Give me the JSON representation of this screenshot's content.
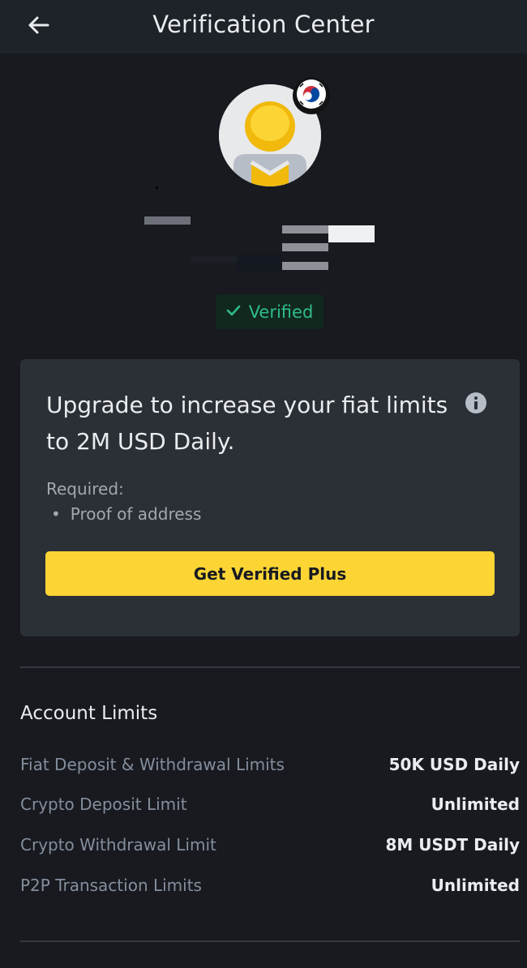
{
  "header": {
    "title": "Verification Center",
    "back_icon": "arrow-left-icon"
  },
  "profile": {
    "avatar_icon": "default-avatar-icon",
    "country_flag_icon": "south-korea-flag-icon",
    "status": "Verified"
  },
  "upgrade_card": {
    "title": "Upgrade to increase your fiat limits to 2M USD Daily.",
    "info_icon": "info-icon",
    "required_label": "Required:",
    "required_items": [
      "Proof of address"
    ],
    "button_label": "Get Verified Plus"
  },
  "account_limits": {
    "heading": "Account Limits",
    "rows": [
      {
        "label": "Fiat Deposit & Withdrawal Limits",
        "value": "50K USD Daily"
      },
      {
        "label": "Crypto Deposit Limit",
        "value": "Unlimited"
      },
      {
        "label": "Crypto Withdrawal Limit",
        "value": "8M USDT Daily"
      },
      {
        "label": "P2P Transaction Limits",
        "value": "Unlimited"
      }
    ]
  },
  "colors": {
    "background": "#181a20",
    "card": "#2b2f36",
    "accent_yellow": "#fcd535",
    "verified_green": "#2ebd85"
  }
}
